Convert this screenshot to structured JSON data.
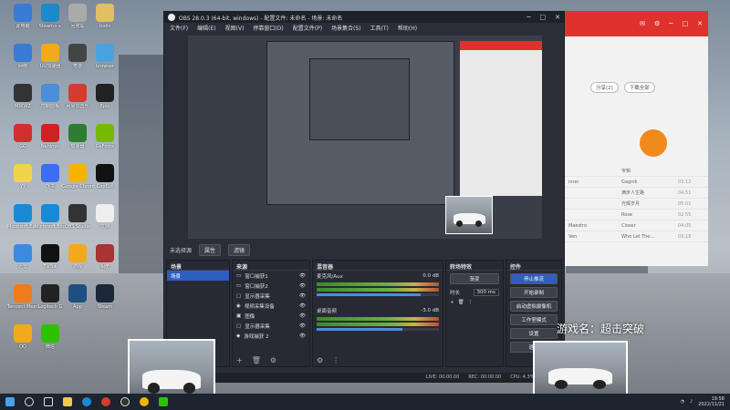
{
  "desktop": {
    "icons": [
      {
        "label": "此电脑",
        "color": "#3a7bd5"
      },
      {
        "label": "Steam++",
        "color": "#1e88c8"
      },
      {
        "label": "回收站",
        "color": "#aaa"
      },
      {
        "label": "tools",
        "color": "#e0c060"
      },
      {
        "label": "网络",
        "color": "#3a7bd5"
      },
      {
        "label": "UU加速器",
        "color": "#f2a91c"
      },
      {
        "label": "奇游",
        "color": "#444"
      },
      {
        "label": "browser",
        "color": "#4aa3e0"
      },
      {
        "label": "MWWZ",
        "color": "#333"
      },
      {
        "label": "控制面板",
        "color": "#4a8fd8"
      },
      {
        "label": "网易云音乐",
        "color": "#d63b2f"
      },
      {
        "label": "Epic",
        "color": "#222"
      },
      {
        "label": "GG",
        "color": "#d32f2f"
      },
      {
        "label": "Nahimic",
        "color": "#cc2222"
      },
      {
        "label": "加速器",
        "color": "#2e7d32"
      },
      {
        "label": "GeForce",
        "color": "#76b900"
      },
      {
        "label": "YY",
        "color": "#f2d34c"
      },
      {
        "label": "飞书",
        "color": "#3b6ef5"
      },
      {
        "label": "Google Chrome",
        "color": "#f4b400"
      },
      {
        "label": "CapCut",
        "color": "#111"
      },
      {
        "label": "Microsoft Edge",
        "color": "#1b8ad6"
      },
      {
        "label": "Microsoft Edge",
        "color": "#1b8ad6"
      },
      {
        "label": "OBS Studio",
        "color": "#333"
      },
      {
        "label": "文档",
        "color": "#eee"
      },
      {
        "label": "迅雷",
        "color": "#3a8be0"
      },
      {
        "label": "TikTok",
        "color": "#111"
      },
      {
        "label": "游戏",
        "color": "#f2a91c"
      },
      {
        "label": "相册",
        "color": "#a33"
      },
      {
        "label": "Tencent Meeting",
        "color": "#f07b1c"
      },
      {
        "label": "Logitech G",
        "color": "#222"
      },
      {
        "label": "App",
        "color": "#1d4f80"
      },
      {
        "label": "Steam",
        "color": "#1b2838"
      },
      {
        "label": "QQ",
        "color": "#f2a91c"
      },
      {
        "label": "微信",
        "color": "#2dc100"
      }
    ]
  },
  "obs": {
    "title": "OBS 28.0.3 (64-bit, windows) - 配置文件: 未命名 - 场景: 未命名",
    "menu": [
      "文件(F)",
      "编辑(E)",
      "视图(V)",
      "停靠窗口(D)",
      "配置文件(P)",
      "场景集合(S)",
      "工具(T)",
      "帮助(H)"
    ],
    "scene_bar": {
      "label": "未选择源",
      "properties": "属性",
      "filters": "滤镜"
    },
    "docks": {
      "scenes": {
        "title": "场景",
        "items": [
          "场景"
        ]
      },
      "sources": {
        "title": "来源",
        "items": [
          "窗口捕获1",
          "窗口捕获2",
          "显示器采集",
          "视频采集设备",
          "图像",
          "显示器采集",
          "游戏捕获 2"
        ]
      },
      "mixer": {
        "title": "混音器",
        "channels": [
          {
            "name": "麦克风/Aux",
            "db": "0.0 dB"
          },
          {
            "name": "桌面音频",
            "db": "-3.0 dB"
          }
        ]
      },
      "transitions": {
        "title": "转场特效",
        "type": "渐变",
        "duration_label": "时长",
        "duration": "300 ms"
      },
      "controls": {
        "title": "控件",
        "buttons": [
          "停止推流",
          "开始录制",
          "启动虚拟摄像机",
          "工作室模式",
          "设置",
          "退出"
        ]
      }
    },
    "status": {
      "live": "LIVE: 00:00:00",
      "rec": "REC: 00:00:00",
      "cpu": "CPU: 4.3%, 25.57 fps"
    }
  },
  "browser": {
    "share": "分享(2)",
    "download": "下载全部",
    "songs": [
      {
        "artist": "",
        "title": "专辑",
        "dur": ""
      },
      {
        "artist": "nner",
        "title": "Gagnik",
        "dur": "03:12"
      },
      {
        "artist": "",
        "title": "满步人生路",
        "dur": "04:51"
      },
      {
        "artist": "",
        "title": "光辉岁月",
        "dur": "05:01"
      },
      {
        "artist": "",
        "title": "Rose",
        "dur": "02:55"
      },
      {
        "artist": "Maestro",
        "title": "Closer",
        "dur": "04:05"
      },
      {
        "artist": "Ven",
        "title": "Who Let The...",
        "dur": "03:18"
      }
    ]
  },
  "overlay": {
    "game_name": "游戏名：超击突破"
  },
  "taskbar": {
    "time": "19:58",
    "date": "2022/11/21"
  }
}
